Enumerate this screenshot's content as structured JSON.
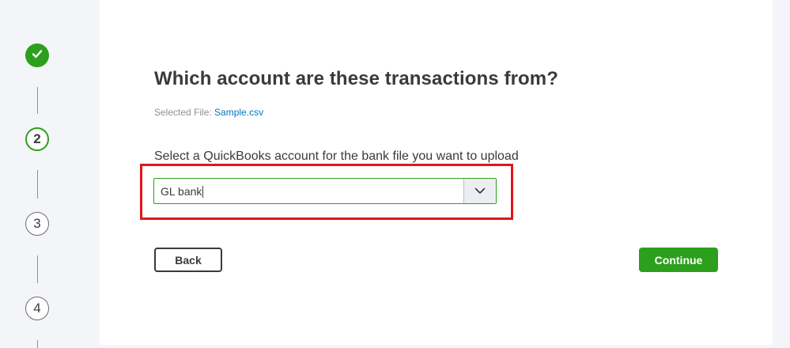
{
  "stepper": {
    "steps": [
      {
        "label": "",
        "state": "done"
      },
      {
        "label": "2",
        "state": "current"
      },
      {
        "label": "3",
        "state": "future"
      },
      {
        "label": "4",
        "state": "future"
      }
    ]
  },
  "main": {
    "title": "Which account are these transactions from?",
    "selected_file_label": "Selected File:",
    "selected_file_name": "Sample.csv",
    "select_label": "Select a QuickBooks account for the bank file you want to upload",
    "account_select": {
      "value": "GL bank"
    },
    "buttons": {
      "back": "Back",
      "continue": "Continue"
    }
  },
  "colors": {
    "accent_green": "#2ca01c",
    "highlight_red": "#e0161b",
    "link_blue": "#0077c5"
  },
  "icons": {
    "done_step": "checkmark-icon",
    "dropdown": "chevron-down-icon"
  }
}
